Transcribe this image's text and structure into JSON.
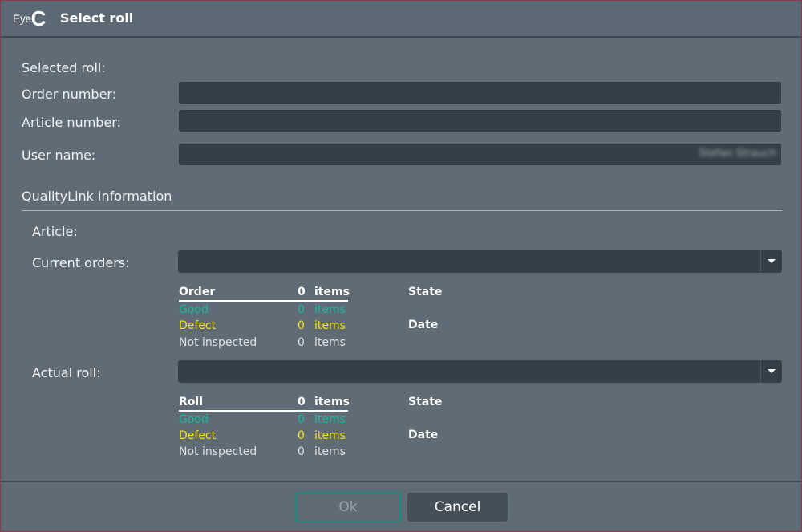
{
  "titlebar": {
    "logo_eye": "Eye",
    "logo_c": "C",
    "title": "Select roll"
  },
  "selected": {
    "heading": "Selected roll:",
    "order_label": "Order number:",
    "order_value": "",
    "article_label": "Article number:",
    "article_value": "",
    "user_label": "User name:",
    "user_value": "Stefan Strauch"
  },
  "qualitylink": {
    "heading": "QualityLink information",
    "article_label": "Article:",
    "current_orders_label": "Current orders:",
    "current_orders_value": "",
    "orders_table": {
      "header": {
        "name": "Order",
        "count": "0",
        "unit": "items",
        "state": "State"
      },
      "rows": [
        {
          "name": "Good",
          "count": "0",
          "unit": "items"
        },
        {
          "name": "Defect",
          "count": "0",
          "unit": "items"
        },
        {
          "name": "Not inspected",
          "count": "0",
          "unit": "items"
        }
      ],
      "date_label": "Date"
    },
    "actual_roll_label": "Actual roll:",
    "actual_roll_value": "",
    "roll_table": {
      "header": {
        "name": "Roll",
        "count": "0",
        "unit": "items",
        "state": "State"
      },
      "rows": [
        {
          "name": "Good",
          "count": "0",
          "unit": "items"
        },
        {
          "name": "Defect",
          "count": "0",
          "unit": "items"
        },
        {
          "name": "Not inspected",
          "count": "0",
          "unit": "items"
        }
      ],
      "date_label": "Date"
    }
  },
  "buttons": {
    "ok": "Ok",
    "cancel": "Cancel"
  },
  "colors": {
    "good": "#1fb89a",
    "defect": "#f5e11c",
    "accent": "#1c8a78",
    "background": "#5f6b75",
    "field": "#343f47"
  }
}
